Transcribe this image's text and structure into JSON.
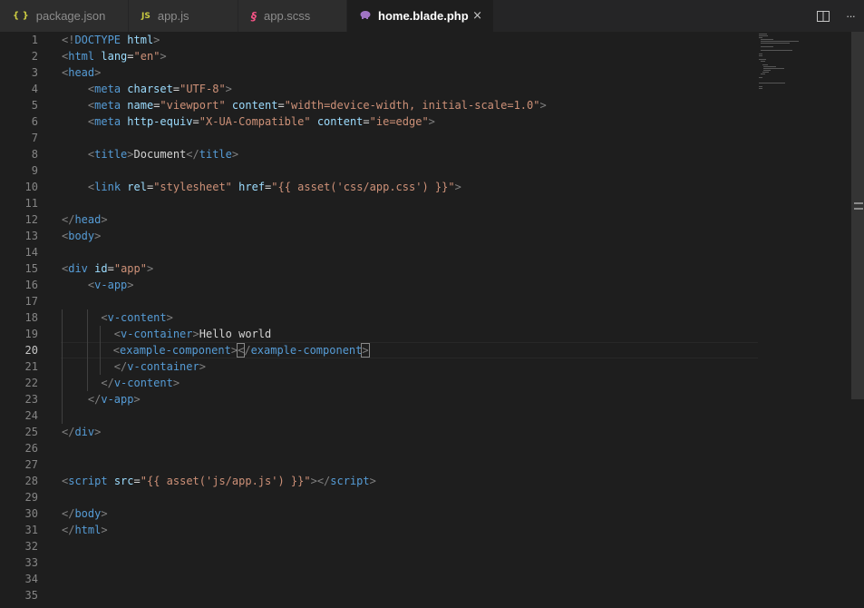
{
  "tabs": [
    {
      "icon": "{ }",
      "icon_color": "#cbcb41",
      "label": "package.json",
      "active": false
    },
    {
      "icon": "JS",
      "icon_color": "#cbcb41",
      "label": "app.js",
      "active": false
    },
    {
      "icon": "§",
      "icon_color": "#f55385",
      "label": "app.scss",
      "active": false
    },
    {
      "icon": "php-elephant",
      "icon_color": "#a074c4",
      "label": "home.blade.php",
      "active": true
    }
  ],
  "tab_close": "×",
  "actions": {
    "split_icon": "split-editor-icon",
    "more": "···"
  },
  "editor": {
    "current_line": 20,
    "line_numbers": [
      "1",
      "2",
      "3",
      "4",
      "5",
      "6",
      "7",
      "8",
      "9",
      "10",
      "11",
      "12",
      "13",
      "14",
      "15",
      "16",
      "17",
      "18",
      "19",
      "20",
      "21",
      "22",
      "23",
      "24",
      "25",
      "26",
      "27",
      "28",
      "29",
      "30",
      "31",
      "32",
      "33",
      "34",
      "35"
    ],
    "lines": [
      [
        [
          "p",
          "<!"
        ],
        [
          "t",
          "DOCTYPE"
        ],
        [
          "x",
          " "
        ],
        [
          "a",
          "html"
        ],
        [
          "p",
          ">"
        ]
      ],
      [
        [
          "p",
          "<"
        ],
        [
          "t",
          "html"
        ],
        [
          "x",
          " "
        ],
        [
          "a",
          "lang"
        ],
        [
          "x",
          "="
        ],
        [
          "s",
          "\"en\""
        ],
        [
          "p",
          ">"
        ]
      ],
      [
        [
          "p",
          "<"
        ],
        [
          "t",
          "head"
        ],
        [
          "p",
          ">"
        ]
      ],
      [
        [
          "x",
          "    "
        ],
        [
          "p",
          "<"
        ],
        [
          "t",
          "meta"
        ],
        [
          "x",
          " "
        ],
        [
          "a",
          "charset"
        ],
        [
          "x",
          "="
        ],
        [
          "s",
          "\"UTF-8\""
        ],
        [
          "p",
          ">"
        ]
      ],
      [
        [
          "x",
          "    "
        ],
        [
          "p",
          "<"
        ],
        [
          "t",
          "meta"
        ],
        [
          "x",
          " "
        ],
        [
          "a",
          "name"
        ],
        [
          "x",
          "="
        ],
        [
          "s",
          "\"viewport\""
        ],
        [
          "x",
          " "
        ],
        [
          "a",
          "content"
        ],
        [
          "x",
          "="
        ],
        [
          "s",
          "\"width=device-width, initial-scale=1.0\""
        ],
        [
          "p",
          ">"
        ]
      ],
      [
        [
          "x",
          "    "
        ],
        [
          "p",
          "<"
        ],
        [
          "t",
          "meta"
        ],
        [
          "x",
          " "
        ],
        [
          "a",
          "http-equiv"
        ],
        [
          "x",
          "="
        ],
        [
          "s",
          "\"X-UA-Compatible\""
        ],
        [
          "x",
          " "
        ],
        [
          "a",
          "content"
        ],
        [
          "x",
          "="
        ],
        [
          "s",
          "\"ie=edge\""
        ],
        [
          "p",
          ">"
        ]
      ],
      [],
      [
        [
          "x",
          "    "
        ],
        [
          "p",
          "<"
        ],
        [
          "t",
          "title"
        ],
        [
          "p",
          ">"
        ],
        [
          "x",
          "Document"
        ],
        [
          "p",
          "</"
        ],
        [
          "t",
          "title"
        ],
        [
          "p",
          ">"
        ]
      ],
      [],
      [
        [
          "x",
          "    "
        ],
        [
          "p",
          "<"
        ],
        [
          "t",
          "link"
        ],
        [
          "x",
          " "
        ],
        [
          "a",
          "rel"
        ],
        [
          "x",
          "="
        ],
        [
          "s",
          "\"stylesheet\""
        ],
        [
          "x",
          " "
        ],
        [
          "a",
          "href"
        ],
        [
          "x",
          "="
        ],
        [
          "s",
          "\"{{ asset('css/app.css') }}\""
        ],
        [
          "p",
          ">"
        ]
      ],
      [],
      [
        [
          "p",
          "</"
        ],
        [
          "t",
          "head"
        ],
        [
          "p",
          ">"
        ]
      ],
      [
        [
          "p",
          "<"
        ],
        [
          "t",
          "body"
        ],
        [
          "p",
          ">"
        ]
      ],
      [],
      [
        [
          "p",
          "<"
        ],
        [
          "t",
          "div"
        ],
        [
          "x",
          " "
        ],
        [
          "a",
          "id"
        ],
        [
          "x",
          "="
        ],
        [
          "s",
          "\"app\""
        ],
        [
          "p",
          ">"
        ]
      ],
      [
        [
          "x",
          "    "
        ],
        [
          "p",
          "<"
        ],
        [
          "t",
          "v-app"
        ],
        [
          "p",
          ">"
        ]
      ],
      [],
      [
        [
          "x",
          "      "
        ],
        [
          "p",
          "<"
        ],
        [
          "t",
          "v-content"
        ],
        [
          "p",
          ">"
        ]
      ],
      [
        [
          "x",
          "        "
        ],
        [
          "p",
          "<"
        ],
        [
          "t",
          "v-container"
        ],
        [
          "p",
          ">"
        ],
        [
          "x",
          "Hello world"
        ]
      ],
      [
        [
          "x",
          "        "
        ],
        [
          "p",
          "<"
        ],
        [
          "t",
          "example-component"
        ],
        [
          "p",
          ">"
        ],
        [
          "c",
          "<"
        ],
        [
          "p",
          "/"
        ],
        [
          "t",
          "example-component"
        ],
        [
          "c",
          ">"
        ]
      ],
      [
        [
          "x",
          "        "
        ],
        [
          "p",
          "</"
        ],
        [
          "t",
          "v-container"
        ],
        [
          "p",
          ">"
        ]
      ],
      [
        [
          "x",
          "      "
        ],
        [
          "p",
          "</"
        ],
        [
          "t",
          "v-content"
        ],
        [
          "p",
          ">"
        ]
      ],
      [
        [
          "x",
          "    "
        ],
        [
          "p",
          "</"
        ],
        [
          "t",
          "v-app"
        ],
        [
          "p",
          ">"
        ]
      ],
      [],
      [
        [
          "p",
          "</"
        ],
        [
          "t",
          "div"
        ],
        [
          "p",
          ">"
        ]
      ],
      [],
      [],
      [
        [
          "p",
          "<"
        ],
        [
          "t",
          "script"
        ],
        [
          "x",
          " "
        ],
        [
          "a",
          "src"
        ],
        [
          "x",
          "="
        ],
        [
          "s",
          "\"{{ asset('js/app.js') }}\""
        ],
        [
          "p",
          "></"
        ],
        [
          "t",
          "script"
        ],
        [
          "p",
          ">"
        ]
      ],
      [],
      [
        [
          "p",
          "</"
        ],
        [
          "t",
          "body"
        ],
        [
          "p",
          ">"
        ]
      ],
      [
        [
          "p",
          "</"
        ],
        [
          "t",
          "html"
        ],
        [
          "p",
          ">"
        ]
      ],
      [],
      [],
      [],
      []
    ]
  }
}
